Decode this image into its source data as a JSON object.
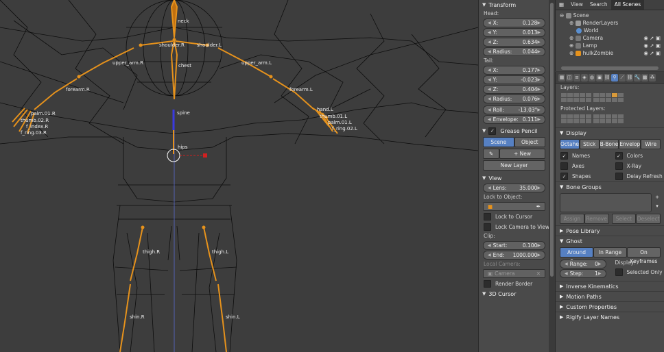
{
  "viewport": {
    "bones": [
      "neck",
      "shoulder.R",
      "shoulder.L",
      "upper_arm.R",
      "upper_arm.L",
      "chest",
      "forearm.R",
      "forearm.L",
      "spine",
      "hips",
      "thigh.R",
      "thigh.L",
      "shin.R",
      "shin.L"
    ],
    "hand_labels_r": [
      "palm.01.R",
      "thumb.02.R",
      "f_index.R",
      "f_ring.03.R"
    ],
    "hand_labels_l": [
      "hand.L",
      "thumb.01.L",
      "palm.01.L",
      "f_ring.02.L"
    ]
  },
  "npanel": {
    "transform": {
      "title": "Transform",
      "head_label": "Head:",
      "head": {
        "x": "0.128",
        "y": "0.013",
        "z": "0.634",
        "radius": "0.044"
      },
      "tail_label": "Tail:",
      "tail": {
        "x": "0.177",
        "y": "-0.023",
        "z": "0.404",
        "radius": "0.076"
      },
      "roll": "-13.03°",
      "envelope": "0.111",
      "labels": {
        "x": "X:",
        "y": "Y:",
        "z": "Z:",
        "radius": "Radius:",
        "roll": "Roll:",
        "envelope": "Envelope:"
      }
    },
    "grease": {
      "title": "Grease Pencil",
      "scene": "Scene",
      "object": "Object",
      "new": "New",
      "new_layer": "New Layer"
    },
    "view": {
      "title": "View",
      "lens_label": "Lens:",
      "lens": "35.000",
      "lock_object": "Lock to Object:",
      "lock_cursor": "Lock to Cursor",
      "lock_camera": "Lock Camera to View",
      "clip": "Clip:",
      "start_label": "Start:",
      "start": "0.100",
      "end_label": "End:",
      "end": "1000.000",
      "local_camera": "Local Camera:",
      "camera": "Camera",
      "render_border": "Render Border"
    },
    "cursor": {
      "title": "3D Cursor"
    }
  },
  "outliner": {
    "tabs": [
      "View",
      "Search",
      "All Scenes"
    ],
    "rows": [
      "Scene",
      "RenderLayers",
      "World",
      "Camera",
      "Lamp",
      "hulkZombie"
    ]
  },
  "props": {
    "layers": "Layers:",
    "protected": "Protected Layers:",
    "display": {
      "title": "Display",
      "modes": [
        "Octahe",
        "Stick",
        "B-Bone",
        "Envelop",
        "Wire"
      ],
      "names": "Names",
      "colors": "Colors",
      "axes": "Axes",
      "xray": "X-Ray",
      "shapes": "Shapes",
      "delay": "Delay Refresh"
    },
    "bone_groups": {
      "title": "Bone Groups",
      "assign": "Assign",
      "remove": "Remove",
      "select": "Select",
      "deselect": "Deselect"
    },
    "pose_library": "Pose Library",
    "ghost": {
      "title": "Ghost",
      "modes": [
        "Around Fra...",
        "In Range",
        "On Keyframes"
      ],
      "range_label": "Range:",
      "range": "0",
      "step_label": "Step:",
      "step": "1",
      "display": "Display:",
      "selected_only": "Selected Only"
    },
    "sections": [
      "Inverse Kinematics",
      "Motion Paths",
      "Custom Properties",
      "Rigify Layer Names"
    ]
  },
  "colors": {
    "bone": "#e6921c",
    "active_blue": "#5680c2",
    "wire": "#0a0a0a"
  }
}
